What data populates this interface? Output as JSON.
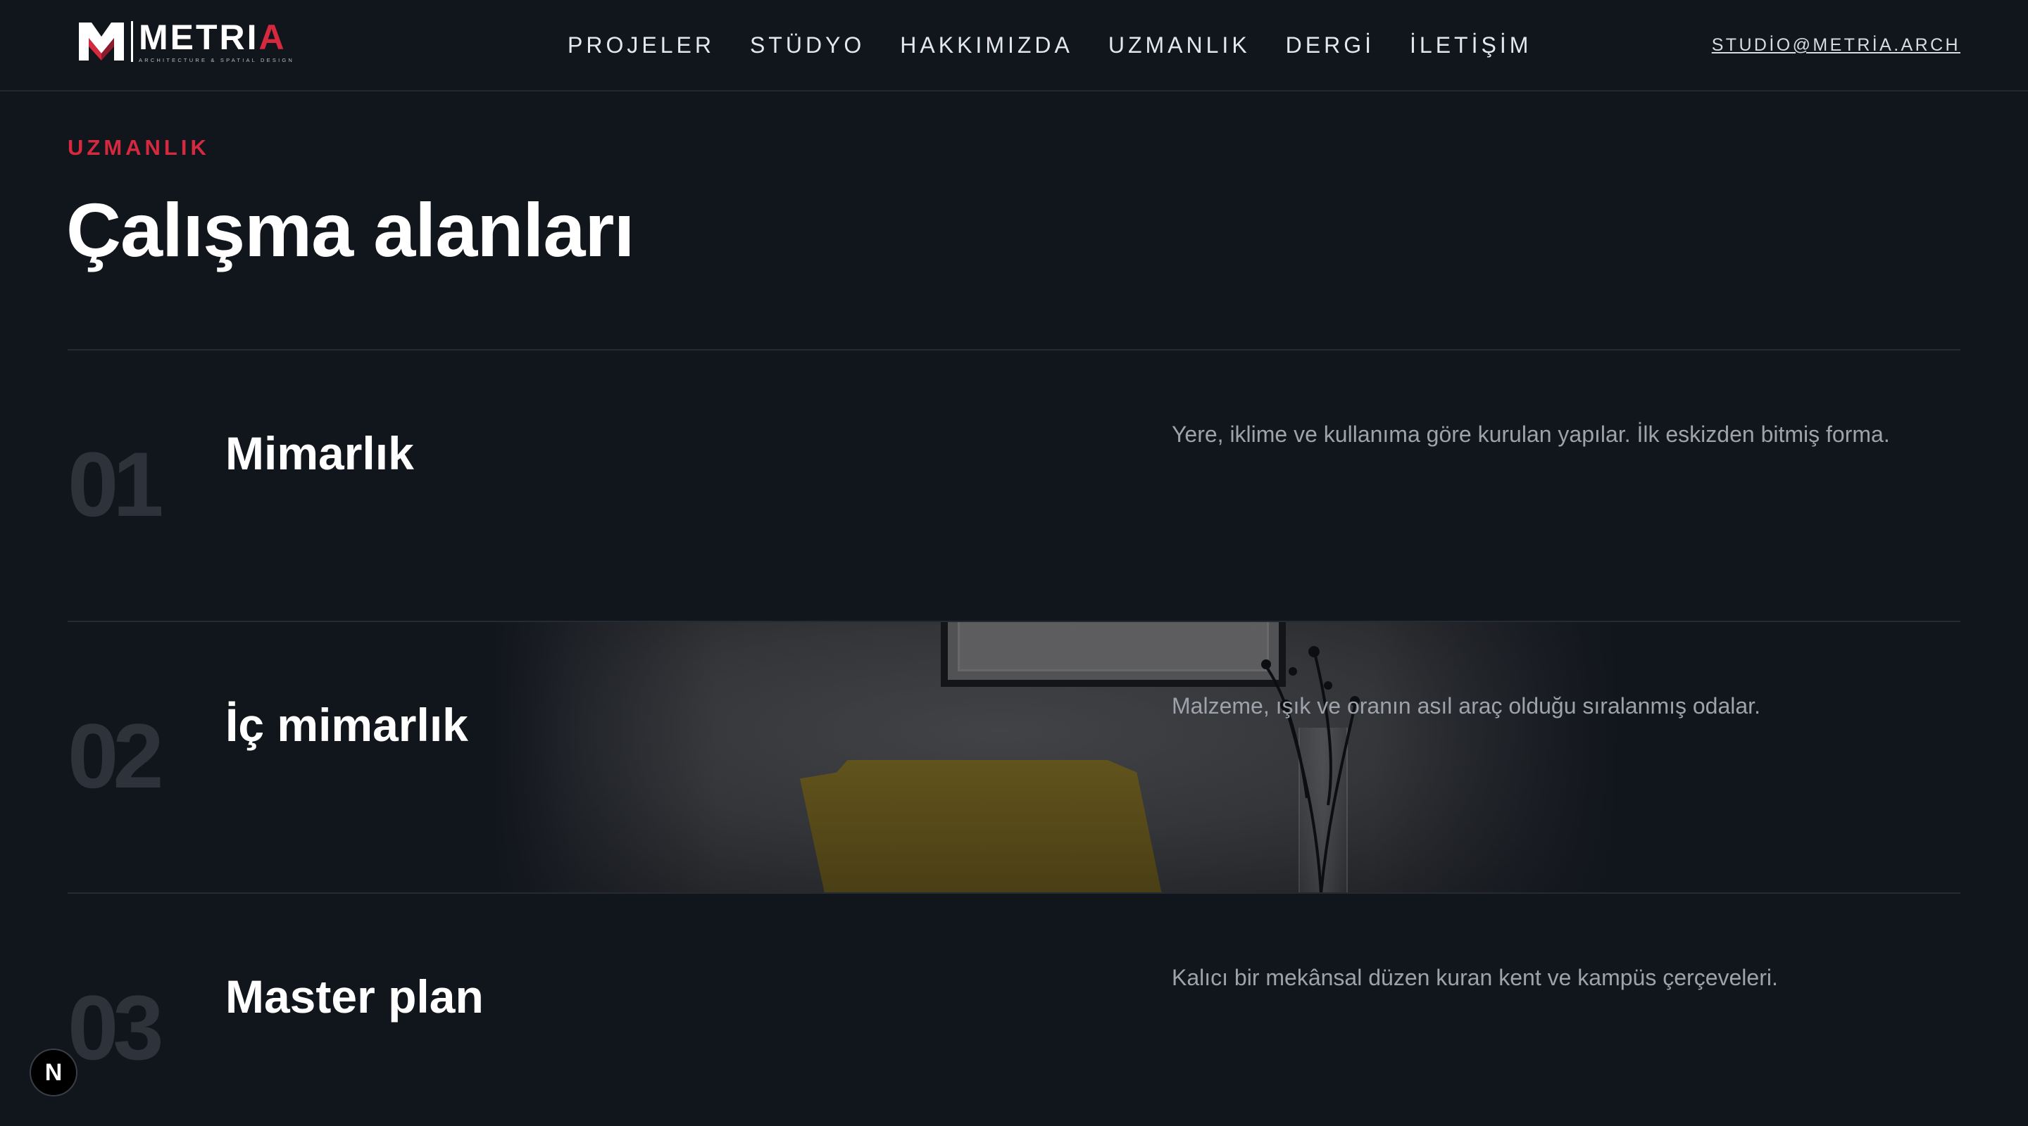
{
  "brand": {
    "name_main": "METRI",
    "name_accent": "A",
    "tagline": "ARCHITECTURE & SPATIAL DESIGN",
    "accent_color": "#d5293f"
  },
  "nav": {
    "items": [
      {
        "label": "PROJELER"
      },
      {
        "label": "STÜDYO"
      },
      {
        "label": "HAKKIMIZDA"
      },
      {
        "label": "UZMANLIK"
      },
      {
        "label": "DERGİ"
      },
      {
        "label": "İLETİŞİM"
      }
    ],
    "email": "STUDİO@METRİA.ARCH"
  },
  "section": {
    "eyebrow": "UZMANLIK",
    "title": "Çalışma alanları"
  },
  "services": [
    {
      "number": "01",
      "title": "Mimarlık",
      "description": "Yere, iklime ve kullanıma göre kurulan yapılar. İlk eskizden bitmiş forma."
    },
    {
      "number": "02",
      "title": "İç mimarlık",
      "description": "Malzeme, ışık ve oranın asıl araç olduğu sıralanmış odalar."
    },
    {
      "number": "03",
      "title": "Master plan",
      "description": "Kalıcı bir mekânsal düzen kuran kent ve kampüs çerçeveleri."
    }
  ],
  "badge": {
    "letter": "N",
    "icon": "nextjs-icon"
  },
  "colors": {
    "background": "#11151c",
    "muted_number": "#2e333b",
    "description": "#9ea2aa"
  }
}
